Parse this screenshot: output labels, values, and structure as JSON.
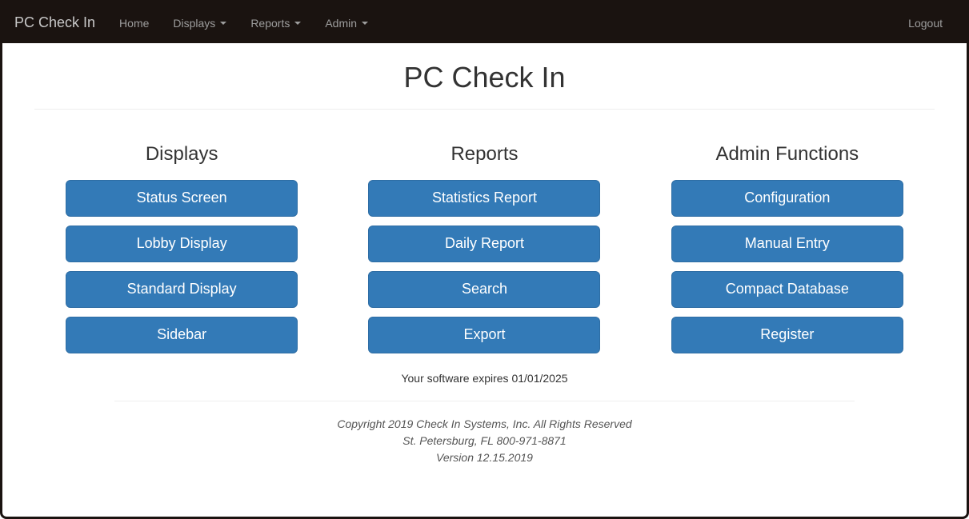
{
  "nav": {
    "brand": "PC Check In",
    "home": "Home",
    "displays": "Displays",
    "reports": "Reports",
    "admin": "Admin",
    "logout": "Logout"
  },
  "page_title": "PC Check In",
  "columns": {
    "displays": {
      "heading": "Displays",
      "buttons": [
        "Status Screen",
        "Lobby Display",
        "Standard Display",
        "Sidebar"
      ]
    },
    "reports": {
      "heading": "Reports",
      "buttons": [
        "Statistics Report",
        "Daily Report",
        "Search",
        "Export"
      ]
    },
    "admin": {
      "heading": "Admin Functions",
      "buttons": [
        "Configuration",
        "Manual Entry",
        "Compact Database",
        "Register"
      ]
    }
  },
  "expires_text": "Your software expires 01/01/2025",
  "footer": {
    "copyright": "Copyright 2019 Check In Systems, Inc. All Rights Reserved",
    "location": "St. Petersburg, FL 800-971-8871",
    "version": "Version 12.15.2019"
  }
}
